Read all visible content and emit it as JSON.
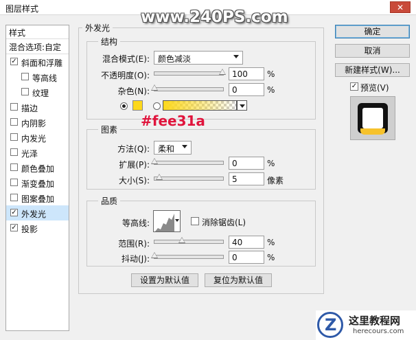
{
  "window": {
    "title": "图层样式",
    "close_glyph": "✕"
  },
  "watermark": "www.240PS.com",
  "style_list": {
    "header": "样式",
    "blend_options": "混合选项:自定",
    "items": [
      {
        "label": "斜面和浮雕",
        "checked": "✓"
      },
      {
        "label": "等高线",
        "checked": ""
      },
      {
        "label": "纹理",
        "checked": ""
      },
      {
        "label": "描边",
        "checked": ""
      },
      {
        "label": "内阴影",
        "checked": ""
      },
      {
        "label": "内发光",
        "checked": ""
      },
      {
        "label": "光泽",
        "checked": ""
      },
      {
        "label": "颜色叠加",
        "checked": ""
      },
      {
        "label": "渐变叠加",
        "checked": ""
      },
      {
        "label": "图案叠加",
        "checked": ""
      },
      {
        "label": "外发光",
        "checked": "✓"
      },
      {
        "label": "投影",
        "checked": "✓"
      }
    ]
  },
  "outer_glow": {
    "title": "外发光",
    "structure": {
      "title": "结构",
      "blend_mode_label": "混合模式(E):",
      "blend_mode_value": "颜色减淡",
      "opacity_label": "不透明度(O):",
      "opacity_value": "100",
      "opacity_unit": "%",
      "noise_label": "杂色(N):",
      "noise_value": "0",
      "noise_unit": "%",
      "glow_color": "#fee31a"
    },
    "elements": {
      "title": "图素",
      "technique_label": "方法(Q):",
      "technique_value": "柔和",
      "spread_label": "扩展(P):",
      "spread_value": "0",
      "spread_unit": "%",
      "size_label": "大小(S):",
      "size_value": "5",
      "size_unit": "像素"
    },
    "quality": {
      "title": "品质",
      "contour_label": "等高线:",
      "antialias_label": "消除锯齿(L)",
      "range_label": "范围(R):",
      "range_value": "40",
      "range_unit": "%",
      "jitter_label": "抖动(J):",
      "jitter_value": "0",
      "jitter_unit": "%"
    },
    "make_default": "设置为默认值",
    "reset_default": "复位为默认值"
  },
  "buttons": {
    "ok": "确定",
    "cancel": "取消",
    "new_style": "新建样式(W)..."
  },
  "preview": {
    "label": "预览(V)",
    "checked": "✓"
  },
  "annotation": "#fee31a",
  "logo": {
    "text": "这里教程网",
    "url": "herecours.com"
  }
}
